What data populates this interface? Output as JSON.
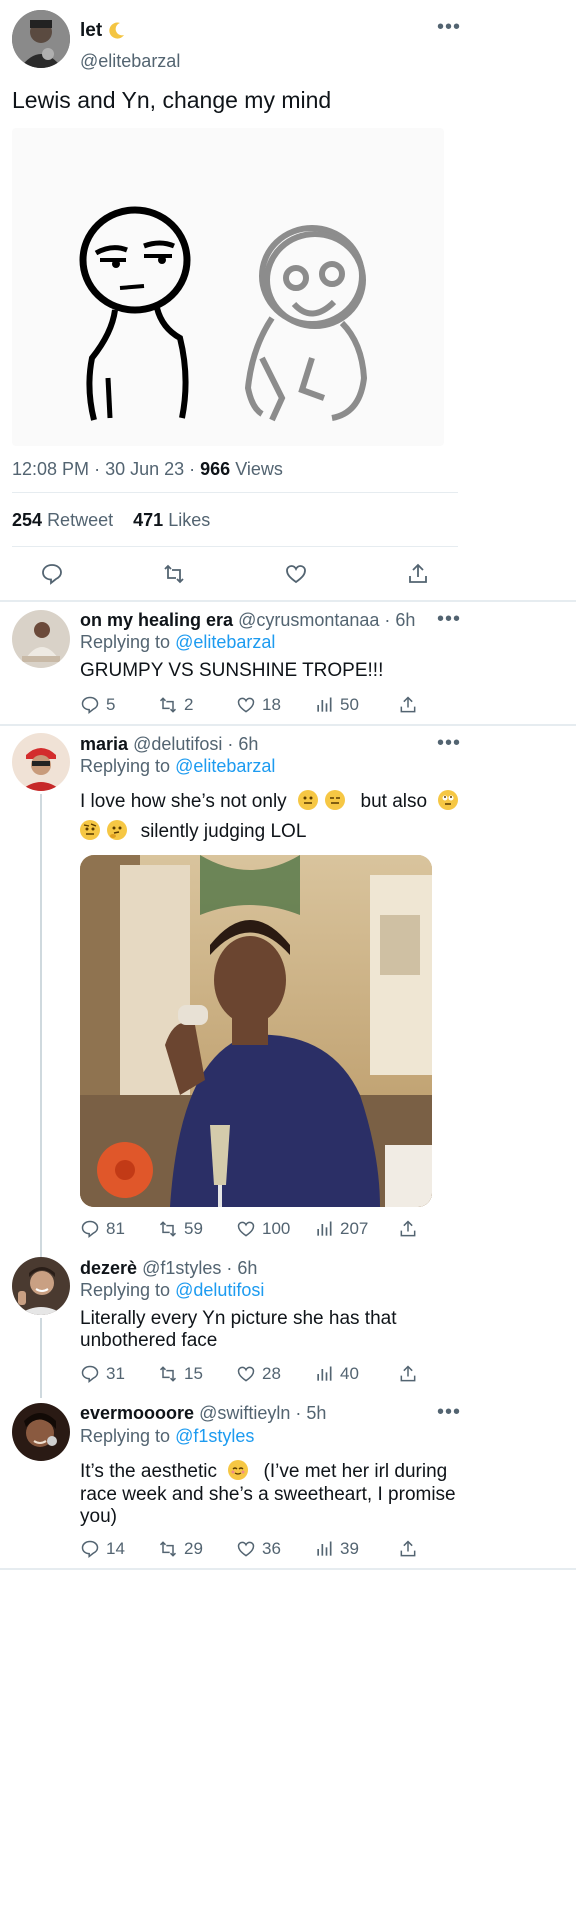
{
  "main_tweet": {
    "name": "let",
    "handle": "@elitebarzal",
    "text": "Lewis and Yn, change my mind",
    "time": "12:08 PM",
    "date": "30 Jun 23",
    "views_count": "966",
    "views_label": "Views",
    "retweets_count": "254",
    "retweets_label": "Retweet",
    "likes_count": "471",
    "likes_label": "Likes"
  },
  "replies": [
    {
      "name": "on my healing era",
      "handle": "@cyrusmontanaa",
      "time": "· 6h",
      "replying_label": "Replying to",
      "replying_to": "@elitebarzal",
      "text": "GRUMPY VS SUNSHINE TROPE!!!",
      "replies": "5",
      "retweets": "2",
      "likes": "18",
      "views": "50"
    },
    {
      "name": "maria",
      "handle": "@delutifosi",
      "time": "· 6h",
      "replying_label": "Replying to",
      "replying_to": "@elitebarzal",
      "text_part1": "I love how she’s not only",
      "text_part2": "but also",
      "text_part3": "silently judging LOL",
      "replies": "81",
      "retweets": "59",
      "likes": "100",
      "views": "207"
    },
    {
      "name": "dezerè",
      "handle": "@f1styles",
      "time": "· 6h",
      "replying_label": "Replying to",
      "replying_to": "@delutifosi",
      "text_line1": "Literally every Yn picture she has that",
      "text_line2": "unbothered face",
      "replies": "31",
      "retweets": "15",
      "likes": "28",
      "views": "40"
    },
    {
      "name": "evermoooore",
      "handle": "@swiftieyln",
      "time": "· 5h",
      "replying_label": "Replying to",
      "replying_to": "@f1styles",
      "text_line1a": "It’s the aesthetic",
      "text_line1b": "(I’ve met her irl during",
      "text_line2": "race week and she’s a sweetheart, I promise",
      "text_line3": "you)",
      "replies": "14",
      "retweets": "29",
      "likes": "36",
      "views": "39"
    }
  ],
  "icons": {
    "reply": "reply-icon",
    "retweet": "retweet-icon",
    "like": "heart-icon",
    "views": "views-icon",
    "share": "share-icon",
    "more": "more-icon"
  },
  "colors": {
    "accent": "#1d9bf0",
    "muted": "#536471",
    "text": "#0f1419",
    "divider": "#e6ecf0"
  }
}
